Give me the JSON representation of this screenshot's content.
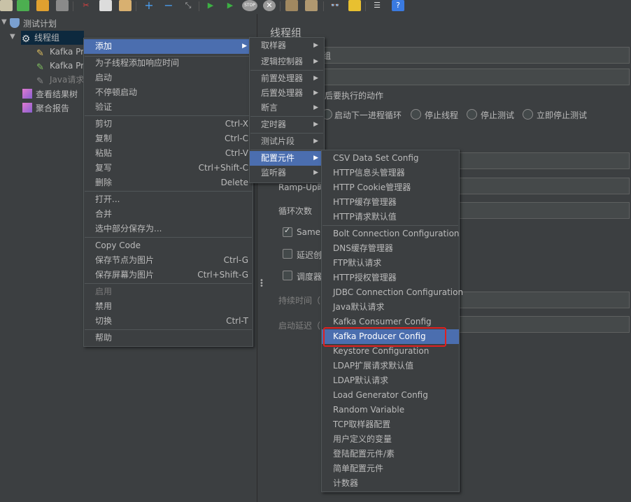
{
  "tree": {
    "root": "测试计划",
    "thread_group": "线程组",
    "children": [
      "Kafka Pro",
      "Kafka Pro",
      "Java请求"
    ],
    "listeners": [
      "查看结果树",
      "聚合报告"
    ]
  },
  "right": {
    "title": "线程组",
    "name_value": "组",
    "action_label": "后要执行的动作",
    "radios": [
      "启动下一进程循环",
      "停止线程",
      "停止测试",
      "立即停止测试"
    ],
    "rampup_label": "Ramp-Up时",
    "loop_label": "循环次数",
    "same_user": "Same u",
    "delay_label": "延迟创",
    "scheduler_label": "调度器",
    "duration_label": "持续时间（",
    "startup_delay_label": "启动延迟（"
  },
  "menu1": {
    "items": [
      {
        "label": "添加",
        "active": true,
        "submenu": true
      },
      {
        "label": "为子线程添加响应时间"
      },
      {
        "label": "启动"
      },
      {
        "label": "不停顿启动"
      },
      {
        "label": "验证"
      },
      {
        "label": "剪切",
        "shortcut": "Ctrl-X"
      },
      {
        "label": "复制",
        "shortcut": "Ctrl-C"
      },
      {
        "label": "粘贴",
        "shortcut": "Ctrl-V"
      },
      {
        "label": "复写",
        "shortcut": "Ctrl+Shift-C"
      },
      {
        "label": "删除",
        "shortcut": "Delete"
      },
      {
        "label": "打开..."
      },
      {
        "label": "合并"
      },
      {
        "label": "选中部分保存为..."
      },
      {
        "label": "Copy Code"
      },
      {
        "label": "保存节点为图片",
        "shortcut": "Ctrl-G"
      },
      {
        "label": "保存屏幕为图片",
        "shortcut": "Ctrl+Shift-G"
      },
      {
        "label": "启用",
        "disabled": true
      },
      {
        "label": "禁用"
      },
      {
        "label": "切换",
        "shortcut": "Ctrl-T"
      },
      {
        "label": "帮助"
      }
    ]
  },
  "menu2": {
    "items": [
      {
        "label": "取样器"
      },
      {
        "label": "逻辑控制器"
      },
      {
        "label": "前置处理器"
      },
      {
        "label": "后置处理器"
      },
      {
        "label": "断言"
      },
      {
        "label": "定时器"
      },
      {
        "label": "测试片段"
      },
      {
        "label": "配置元件",
        "active": true
      },
      {
        "label": "监听器"
      }
    ]
  },
  "menu3": {
    "items": [
      "CSV Data Set Config",
      "HTTP信息头管理器",
      "HTTP Cookie管理器",
      "HTTP缓存管理器",
      "HTTP请求默认值",
      "Bolt Connection Configuration",
      "DNS缓存管理器",
      "FTP默认请求",
      "HTTP授权管理器",
      "JDBC Connection Configuration",
      "Java默认请求",
      "Kafka Consumer Config",
      "Kafka Producer Config",
      "Keystore Configuration",
      "LDAP扩展请求默认值",
      "LDAP默认请求",
      "Load Generator Config",
      "Random Variable",
      "TCP取样器配置",
      "用户定义的变量",
      "登陆配置元件/素",
      "简单配置元件",
      "计数器"
    ],
    "active_index": 12
  },
  "colors": {
    "background": "#3c3f41",
    "menu_active": "#4b6eaf",
    "highlight_border": "#e02020",
    "tree_selected": "#0d293e"
  }
}
